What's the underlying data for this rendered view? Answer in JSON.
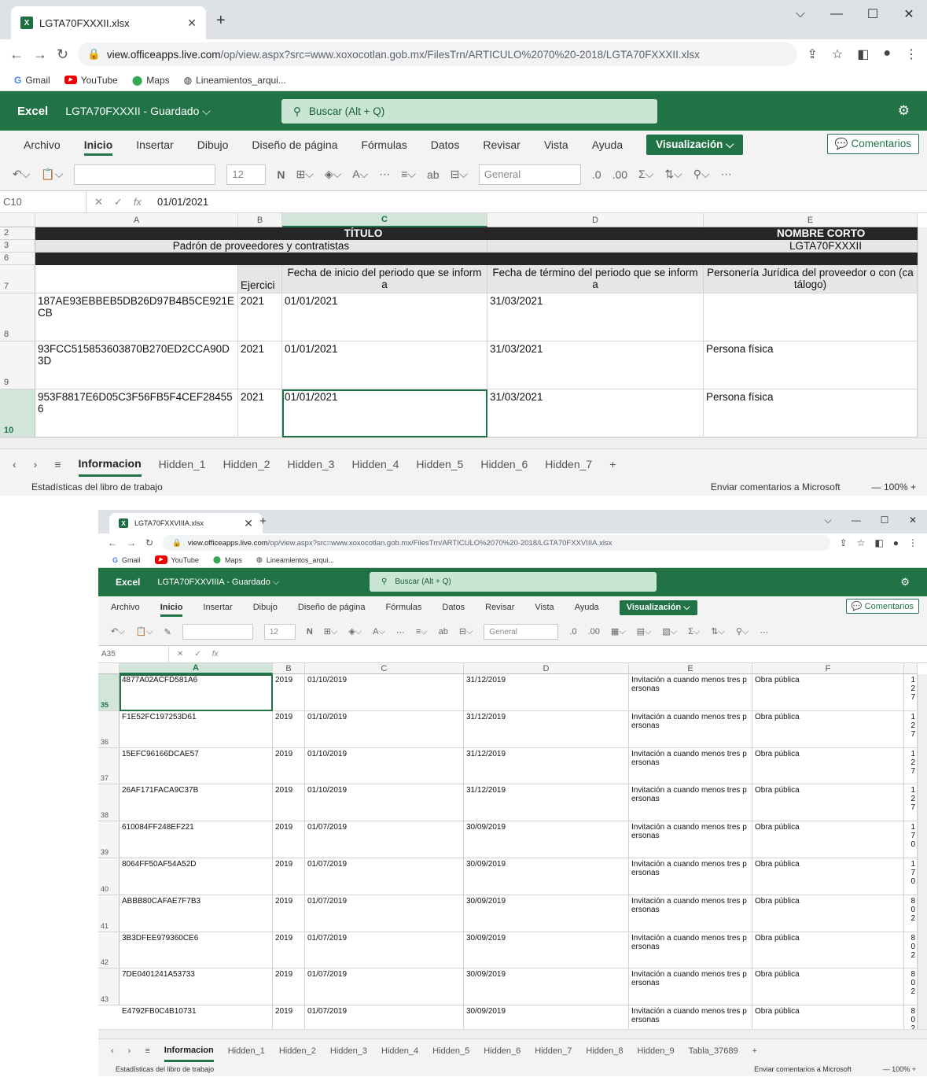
{
  "w1": {
    "tab_title": "LGTA70FXXXII.xlsx",
    "url_domain": "view.officeapps.live.com",
    "url_path": "/op/view.aspx?src=www.xoxocotlan.gob.mx/FilesTrn/ARTICULO%2070%20-2018/LGTA70FXXXII.xlsx",
    "bookmarks": [
      "Gmail",
      "YouTube",
      "Maps",
      "Lineamientos_arqui..."
    ],
    "app_name": "Excel",
    "file_status": "LGTA70FXXXII - Guardado ⌵",
    "search_placeholder": "Buscar (Alt + Q)",
    "menu": [
      "Archivo",
      "Inicio",
      "Insertar",
      "Dibujo",
      "Diseño de página",
      "Fórmulas",
      "Datos",
      "Revisar",
      "Vista",
      "Ayuda"
    ],
    "view_mode": "Visualización ⌵",
    "comments": "Comentarios",
    "font_size": "12",
    "number_format": "General",
    "name_box": "C10",
    "formula_value": "01/01/2021",
    "columns": [
      "A",
      "B",
      "C",
      "D",
      "E"
    ],
    "rows": {
      "r2": "2",
      "r3": "3",
      "r6": "6",
      "r7": "7",
      "r8": "8",
      "r9": "9",
      "r10": "10"
    },
    "titulo": "TÍTULO",
    "nombre_corto": "NOMBRE CORTO",
    "titulo_val": "Padrón de proveedores y contratistas",
    "nombre_corto_val": "LGTA70FXXXII",
    "headers": [
      "",
      "Ejercicio",
      "Fecha de inicio del periodo que se informa",
      "Fecha de término del periodo que se informa",
      "Personería Jurídica del proveedor o con (catálogo)"
    ],
    "data": [
      [
        "187AE93EBBEB5DB26D97B4B5CE921ECB",
        "2021",
        "01/01/2021",
        "31/03/2021",
        ""
      ],
      [
        "93FCC515853603870B270ED2CCA90D3D",
        "2021",
        "01/01/2021",
        "31/03/2021",
        "Persona física"
      ],
      [
        "953F8817E6D05C3F56FB5F4CEF284556",
        "2021",
        "01/01/2021",
        "31/03/2021",
        "Persona física"
      ]
    ],
    "sheets": [
      "Informacion",
      "Hidden_1",
      "Hidden_2",
      "Hidden_3",
      "Hidden_4",
      "Hidden_5",
      "Hidden_6",
      "Hidden_7"
    ],
    "status_left": "Estadísticas del libro de trabajo",
    "status_feedback": "Enviar comentarios a Microsoft",
    "zoom": "— 100% +"
  },
  "w2": {
    "tab_title": "LGTA70FXXVIIIA.xlsx",
    "url_domain": "view.officeapps.live.com",
    "url_path": "/op/view.aspx?src=www.xoxocotlan.gob.mx/FilesTrn/ARTICULO%2070%20-2018/LGTA70FXXVIIIA.xlsx",
    "bookmarks": [
      "Gmail",
      "YouTube",
      "Maps",
      "Lineamientos_arqui..."
    ],
    "app_name": "Excel",
    "file_status": "LGTA70FXXVIIIA - Guardado ⌵",
    "search_placeholder": "Buscar (Alt + Q)",
    "menu": [
      "Archivo",
      "Inicio",
      "Insertar",
      "Dibujo",
      "Diseño de página",
      "Fórmulas",
      "Datos",
      "Revisar",
      "Vista",
      "Ayuda"
    ],
    "view_mode": "Visualización ⌵",
    "comments": "Comentarios",
    "font_size": "12",
    "number_format": "General",
    "name_box": "A35",
    "formula_value": "",
    "columns": [
      "A",
      "B",
      "C",
      "D",
      "E",
      "F"
    ],
    "row_nums": [
      "35",
      "36",
      "37",
      "38",
      "39",
      "40",
      "41",
      "42",
      "43"
    ],
    "data": [
      [
        "4877A02ACFD581A6",
        "2019",
        "01/10/2019",
        "31/12/2019",
        "Invitación a cuando menos tres personas",
        "Obra pública",
        "127"
      ],
      [
        "F1E52FC197253D61",
        "2019",
        "01/10/2019",
        "31/12/2019",
        "Invitación a cuando menos tres personas",
        "Obra pública",
        "127"
      ],
      [
        "15EFC96166DCAE57",
        "2019",
        "01/10/2019",
        "31/12/2019",
        "Invitación a cuando menos tres personas",
        "Obra pública",
        "127"
      ],
      [
        "26AF171FACA9C37B",
        "2019",
        "01/10/2019",
        "31/12/2019",
        "Invitación a cuando menos tres personas",
        "Obra pública",
        "127"
      ],
      [
        "610084FF248EF221",
        "2019",
        "01/07/2019",
        "30/09/2019",
        "Invitación a cuando menos tres personas",
        "Obra pública",
        "170"
      ],
      [
        "8064FF50AF54A52D",
        "2019",
        "01/07/2019",
        "30/09/2019",
        "Invitación a cuando menos tres personas",
        "Obra pública",
        "170"
      ],
      [
        "ABBB80CAFAE7F7B3",
        "2019",
        "01/07/2019",
        "30/09/2019",
        "Invitación a cuando menos tres personas",
        "Obra pública",
        "802"
      ],
      [
        "3B3DFEE979360CE6",
        "2019",
        "01/07/2019",
        "30/09/2019",
        "Invitación a cuando menos tres personas",
        "Obra pública",
        "802"
      ],
      [
        "7DE0401241A53733",
        "2019",
        "01/07/2019",
        "30/09/2019",
        "Invitación a cuando menos tres personas",
        "Obra pública",
        "802"
      ],
      [
        "E4792FB0C4B10731",
        "2019",
        "01/07/2019",
        "30/09/2019",
        "Invitación a cuando menos tres personas",
        "Obra pública",
        "802"
      ]
    ],
    "sheets": [
      "Informacion",
      "Hidden_1",
      "Hidden_2",
      "Hidden_3",
      "Hidden_4",
      "Hidden_5",
      "Hidden_6",
      "Hidden_7",
      "Hidden_8",
      "Hidden_9",
      "Tabla_37689"
    ],
    "status_left": "Estadísticas del libro de trabajo",
    "status_feedback": "Enviar comentarios a Microsoft",
    "zoom": "— 100% +"
  }
}
